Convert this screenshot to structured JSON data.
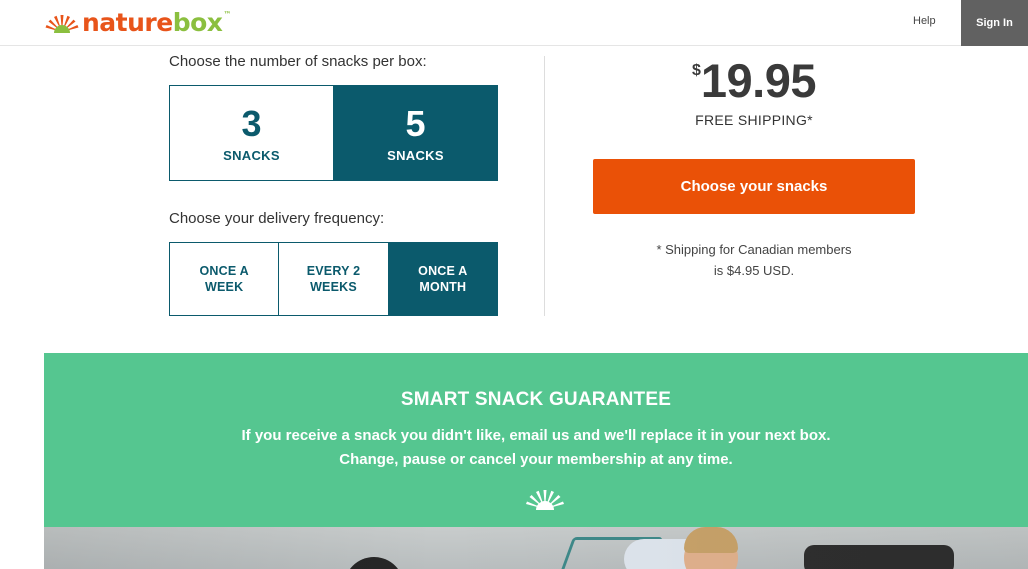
{
  "header": {
    "logo": {
      "part1": "nature",
      "part2": "box",
      "tm": "™",
      "icon": "sunburst-logo-icon"
    },
    "help_label": "Help",
    "signin_label": "Sign In"
  },
  "snacks": {
    "label": "Choose the number of snacks per box:",
    "options": [
      {
        "number": "3",
        "word": "SNACKS",
        "selected": false
      },
      {
        "number": "5",
        "word": "SNACKS",
        "selected": true
      }
    ]
  },
  "frequency": {
    "label": "Choose your delivery frequency:",
    "options": [
      {
        "label": "ONCE A WEEK",
        "selected": false
      },
      {
        "label": "EVERY 2 WEEKS",
        "selected": false
      },
      {
        "label": "ONCE A MONTH",
        "selected": true
      }
    ]
  },
  "pricing": {
    "currency": "$",
    "amount": "19.95",
    "shipping": "FREE SHIPPING*",
    "cta_label": "Choose your snacks",
    "note_line1": "* Shipping for Canadian members",
    "note_line2": "is $4.95 USD."
  },
  "guarantee": {
    "title": "SMART SNACK GUARANTEE",
    "line1": "If you receive a snack you didn't like, email us and we'll replace it in your next box.",
    "line2": "Change, pause or cancel your membership at any time.",
    "icon": "sunburst-icon"
  },
  "colors": {
    "teal": "#0b5a6c",
    "orange": "#ea5107",
    "green": "#55c690",
    "logo_orange": "#e8541a",
    "logo_green": "#8bbf3f",
    "signin_bg": "#616161"
  }
}
